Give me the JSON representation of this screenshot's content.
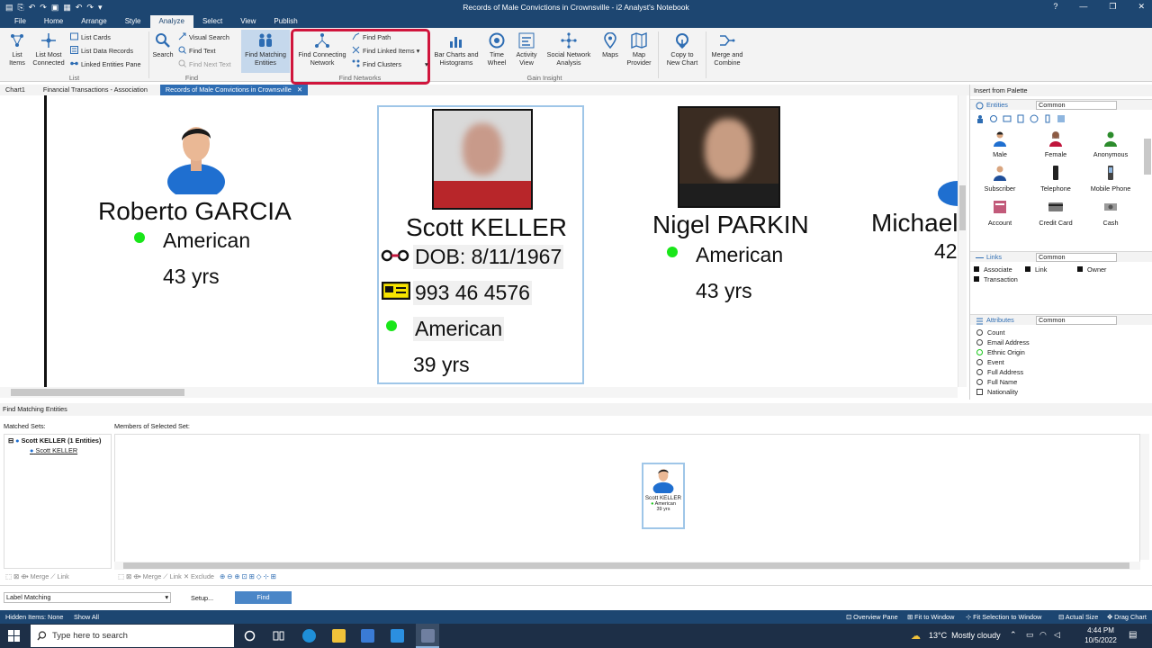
{
  "window": {
    "title": "Records of Male Convictions in Crownsville - i2 Analyst's Notebook",
    "controls": [
      "?",
      "—",
      "❐",
      "✕"
    ]
  },
  "menus": [
    "File",
    "Home",
    "Arrange",
    "Style",
    "Analyze",
    "Select",
    "View",
    "Publish"
  ],
  "active_menu": "Analyze",
  "ribbon": {
    "list_items": "List\nItems",
    "list_most_connected": "List Most\nConnected",
    "list_cards": "List Cards",
    "list_data_records": "List Data Records",
    "linked_entities_pane": "Linked Entities Pane",
    "group_list": "List",
    "search": "Search",
    "visual_search": "Visual Search",
    "find_text": "Find Text",
    "find_next_text": "Find Next Text",
    "group_find": "Find",
    "find_matching_entities": "Find Matching\nEntities",
    "find_connecting_network": "Find Connecting\nNetwork",
    "find_path": "Find Path",
    "find_linked_items": "Find Linked Items",
    "find_clusters": "Find Clusters",
    "group_find_networks": "Find Networks",
    "bar_charts": "Bar Charts and\nHistograms",
    "time_wheel": "Time\nWheel",
    "activity_view": "Activity\nView",
    "social_network": "Social Network\nAnalysis",
    "maps": "Maps",
    "map_provider": "Map\nProvider",
    "group_gain_insight": "Gain Insight",
    "copy_to_new_chart": "Copy to\nNew Chart",
    "merge_and_combine": "Merge and\nCombine"
  },
  "chart_tabs": [
    "Chart1",
    "Financial Transactions - Association",
    "Records of Male Convictions in Crownsville"
  ],
  "canvas": {
    "p1": {
      "name": "Roberto GARCIA",
      "nationality": "American",
      "age": "43 yrs"
    },
    "p2": {
      "name": "Scott KELLER",
      "dob": "DOB: 8/11/1967",
      "phone": "993 46 4576",
      "nationality": "American",
      "age": "39 yrs"
    },
    "p3": {
      "name": "Nigel PARKIN",
      "nationality": "American",
      "age": "43 yrs"
    },
    "p4": {
      "name": "Michael",
      "age": "42"
    }
  },
  "palette": {
    "title": "Insert from Palette",
    "entities_label": "Entities",
    "entities_set": "Common",
    "entities": [
      {
        "label": "Male",
        "icon": "male-person-icon"
      },
      {
        "label": "Female",
        "icon": "female-person-icon"
      },
      {
        "label": "Anonymous",
        "icon": "anonymous-person-icon"
      },
      {
        "label": "Subscriber",
        "icon": "subscriber-icon"
      },
      {
        "label": "Telephone",
        "icon": "telephone-icon"
      },
      {
        "label": "Mobile Phone",
        "icon": "mobile-phone-icon"
      },
      {
        "label": "Account",
        "icon": "account-icon"
      },
      {
        "label": "Credit Card",
        "icon": "credit-card-icon"
      },
      {
        "label": "Cash",
        "icon": "cash-icon"
      }
    ],
    "links_label": "Links",
    "links_set": "Common",
    "links": [
      "Associate",
      "Link",
      "Owner",
      "Transaction"
    ],
    "attributes_label": "Attributes",
    "attributes_set": "Common",
    "attributes": [
      "Count",
      "Email Address",
      "Ethnic Origin",
      "Event",
      "Full Address",
      "Full Name",
      "Nationality"
    ]
  },
  "fme": {
    "title": "Find Matching Entities",
    "matched_sets": "Matched Sets:",
    "members": "Members of Selected Set:",
    "set_label": "Scott KELLER (1 Entities)",
    "set_member": "Scott KELLER",
    "card_name": "Scott KELLER",
    "card_nat": "American",
    "card_age": "39 yrs",
    "merge": "Merge",
    "link": "Link",
    "exclude": "Exclude",
    "mode": "Label Matching",
    "setup": "Setup...",
    "find": "Find"
  },
  "status": {
    "hidden": "Hidden Items: None",
    "show_all": "Show All",
    "overview": "Overview Pane",
    "fit_window": "Fit to Window",
    "fit_selection": "Fit Selection to Window",
    "actual_size": "Actual Size",
    "drag_chart": "Drag Chart"
  },
  "taskbar": {
    "search_placeholder": "Type here to search",
    "weather": "13°C  Mostly cloudy",
    "time": "4:44 PM",
    "date": "10/5/2022"
  }
}
